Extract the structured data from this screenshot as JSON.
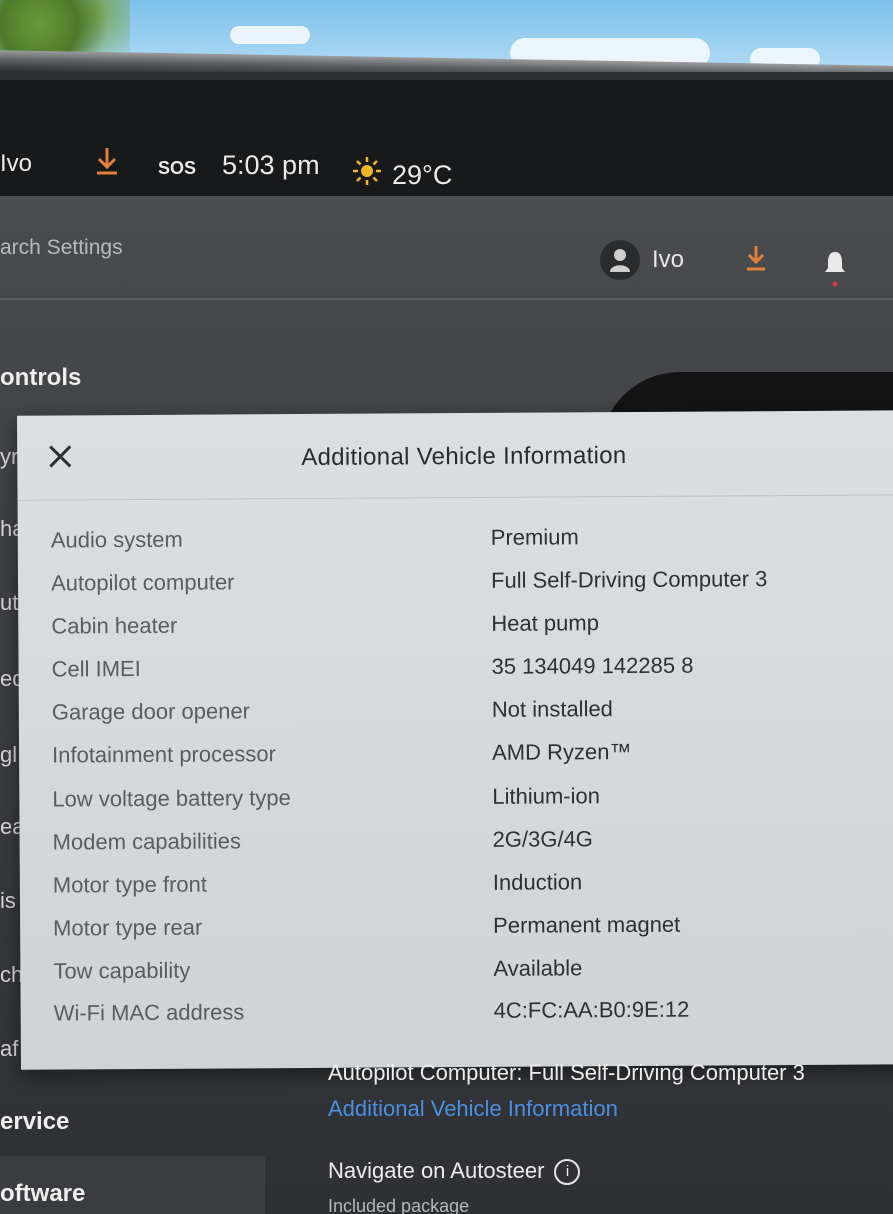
{
  "statusbar": {
    "user": "Ivo",
    "sos": "SOS",
    "time": "5:03 pm",
    "temperature": "29°C"
  },
  "header": {
    "search_placeholder": "arch Settings",
    "user_name": "Ivo"
  },
  "sidebar": {
    "controls": "ontrols",
    "service": "ervice",
    "software": "oftware",
    "fragments": [
      "yr",
      "ha",
      "ut",
      "ed",
      "gl",
      "ea",
      "is",
      "ch",
      "af"
    ]
  },
  "modal": {
    "title": "Additional Vehicle Information",
    "rows": [
      {
        "label": "Audio system",
        "value": "Premium"
      },
      {
        "label": "Autopilot computer",
        "value": "Full Self-Driving Computer 3"
      },
      {
        "label": "Cabin heater",
        "value": "Heat pump"
      },
      {
        "label": "Cell IMEI",
        "value": "35 134049 142285 8"
      },
      {
        "label": "Garage door opener",
        "value": "Not installed"
      },
      {
        "label": "Infotainment processor",
        "value": "AMD Ryzen™"
      },
      {
        "label": "Low voltage battery type",
        "value": "Lithium-ion"
      },
      {
        "label": "Modem capabilities",
        "value": "2G/3G/4G"
      },
      {
        "label": "Motor type front",
        "value": "Induction"
      },
      {
        "label": "Motor type rear",
        "value": "Permanent magnet"
      },
      {
        "label": "Tow capability",
        "value": "Available"
      },
      {
        "label": "Wi-Fi MAC address",
        "value": "4C:FC:AA:B0:9E:12"
      }
    ]
  },
  "software_panel": {
    "autopilot_computer": "Autopilot Computer: Full Self-Driving Computer 3",
    "additional_info_link": "Additional Vehicle Information",
    "navigate_on_autosteer": "Navigate on Autosteer",
    "included_package": "Included package"
  },
  "colors": {
    "accent_orange": "#e2813a",
    "link_blue": "#4a90e2",
    "modal_bg": "#d8dbde"
  },
  "icons": [
    "download-icon",
    "sos-icon",
    "sun-icon",
    "person-icon",
    "bell-icon",
    "close-icon",
    "info-icon"
  ]
}
